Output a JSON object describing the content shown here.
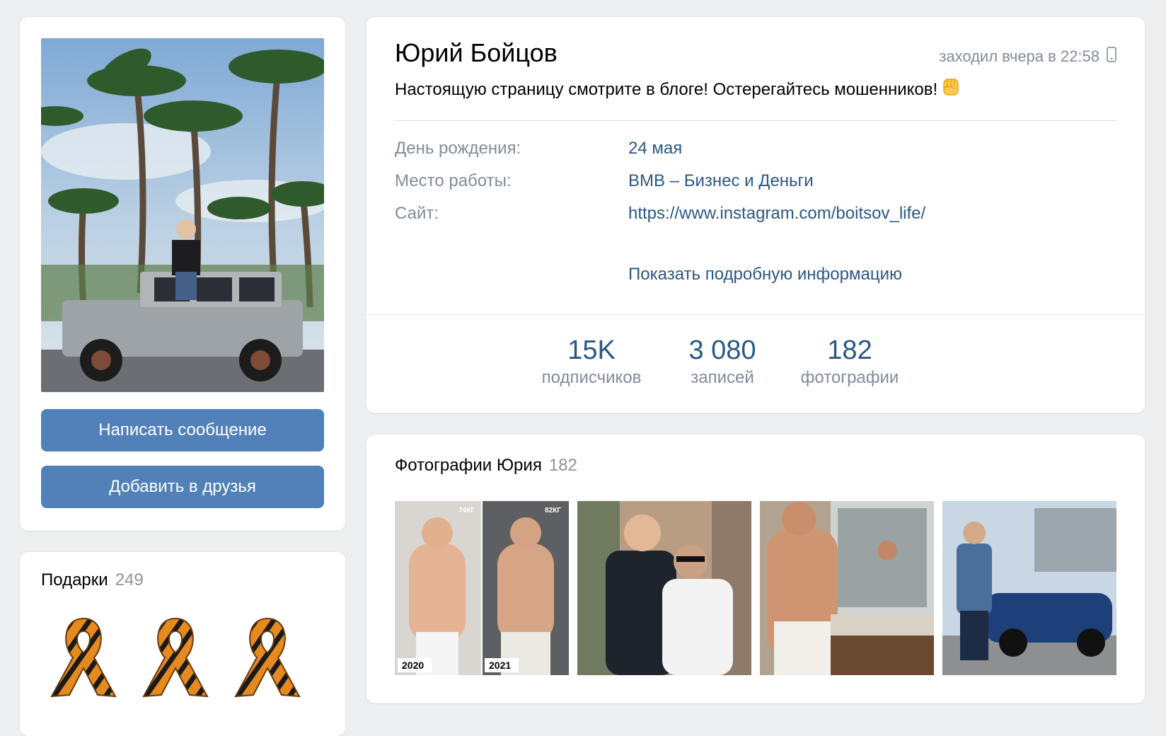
{
  "profile": {
    "name": "Юрий Бойцов",
    "last_seen": "заходил вчера в 22:58",
    "status": "Настоящую страницу смотрите в блоге! Остерегайтесь мошенников!",
    "status_emoji": "fist-emoji"
  },
  "actions": {
    "message_label": "Написать сообщение",
    "add_friend_label": "Добавить в друзья"
  },
  "info": {
    "rows": [
      {
        "label": "День рождения:",
        "value": "24 мая"
      },
      {
        "label": "Место работы:",
        "value": "BMB – Бизнес и Деньги"
      },
      {
        "label": "Сайт:",
        "value": "https://www.instagram.com/boitsov_life/"
      }
    ],
    "show_more": "Показать подробную информацию"
  },
  "counters": [
    {
      "value": "15K",
      "label": "подписчиков"
    },
    {
      "value": "3 080",
      "label": "записей"
    },
    {
      "value": "182",
      "label": "фотографии"
    }
  ],
  "gifts": {
    "title": "Подарки",
    "count": "249",
    "items": [
      "st-george-ribbon",
      "st-george-ribbon",
      "st-george-ribbon"
    ]
  },
  "photos": {
    "title": "Фотографии Юрия",
    "count": "182",
    "items": [
      {
        "caption_left": "2020",
        "caption_right": "2021",
        "tag_left": "74КГ",
        "tag_right": "82КГ"
      },
      {
        "desc": "two-men-photo"
      },
      {
        "desc": "mirror-photo"
      },
      {
        "desc": "car-photo"
      }
    ]
  },
  "colors": {
    "background": "#edeef0",
    "button": "#5181b8",
    "link": "#2a5885",
    "muted": "#818c99"
  }
}
